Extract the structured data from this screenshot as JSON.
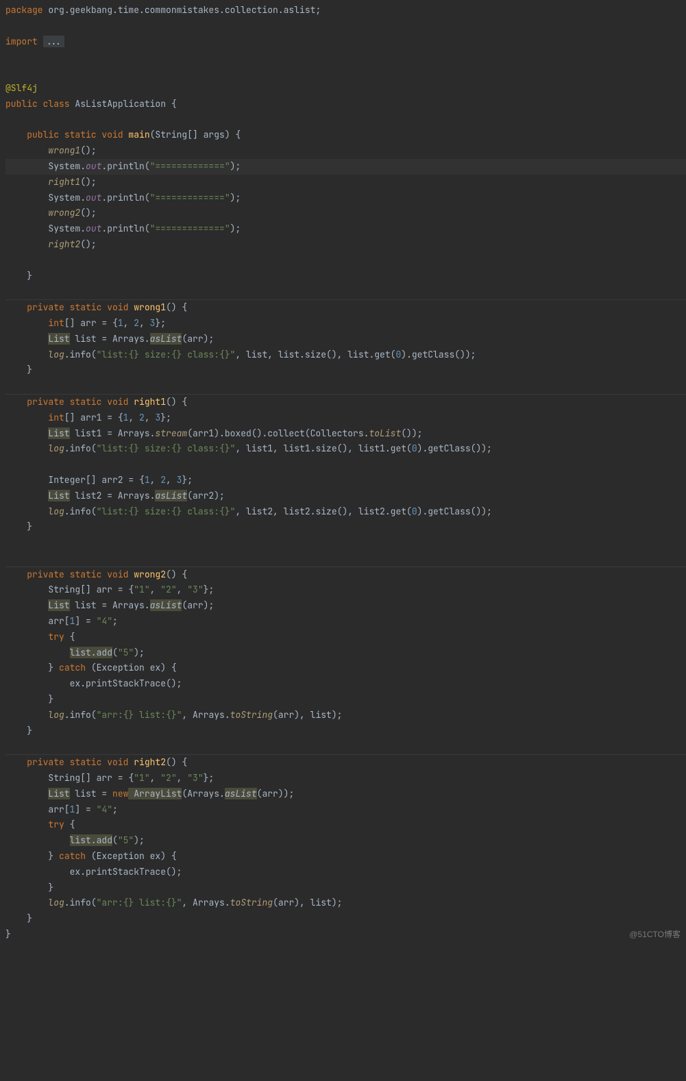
{
  "package_kw": "package",
  "package_name": "org.geekbang.time.commonmistakes.collection.aslist",
  "import_kw": "import",
  "import_dots": "...",
  "annotation": "@Slf4j",
  "class_decl": {
    "mods": "public class",
    "name": "AsListApplication",
    "open": " {"
  },
  "main": {
    "sig_mods": "public static void",
    "name": "main",
    "params": "(String[] args) {",
    "body": [
      {
        "call": "wrong1",
        "after": "();"
      },
      {
        "sysout_pre": "System.",
        "out": "out",
        "println": ".println(",
        "str": "\"=============\"",
        "end": ");"
      },
      {
        "call": "right1",
        "after": "();"
      },
      {
        "sysout_pre": "System.",
        "out": "out",
        "println": ".println(",
        "str": "\"=============\"",
        "end": ");"
      },
      {
        "call": "wrong2",
        "after": "();"
      },
      {
        "sysout_pre": "System.",
        "out": "out",
        "println": ".println(",
        "str": "\"=============\"",
        "end": ");"
      },
      {
        "call": "right2",
        "after": "();"
      }
    ]
  },
  "wrong1": {
    "sig_mods": "private static void",
    "name": "wrong1",
    "params": "() {",
    "l1_kw": "int",
    "l1_rest": "[] arr = {",
    "l1_n1": "1",
    "l1_n2": "2",
    "l1_n3": "3",
    "l1_end": "};",
    "l2_list": "List",
    "l2_mid": " list = Arrays.",
    "l2_aslist": "asList",
    "l2_end": "(arr);",
    "l3_log": "log",
    "l3_mid": ".info(",
    "l3_str": "\"list:{} size:{} class:{}\"",
    "l3_args": ", list, list.size(), list.get(",
    "l3_zero": "0",
    "l3_end": ").getClass());"
  },
  "right1": {
    "sig_mods": "private static void",
    "name": "right1",
    "params": "() {",
    "l1_kw": "int",
    "l1_rest": "[] arr1 = {",
    "l1_n1": "1",
    "l1_n2": "2",
    "l1_n3": "3",
    "l1_end": "};",
    "l2_list": "List",
    "l2_mid": " list1 = Arrays.",
    "l2_stream": "stream",
    "l2_after_stream": "(arr1).boxed().collect(Collectors.",
    "l2_tolist": "toList",
    "l2_end": "());",
    "l3_log": "log",
    "l3_mid": ".info(",
    "l3_str": "\"list:{} size:{} class:{}\"",
    "l3_args": ", list1, list1.size(), list1.get(",
    "l3_zero": "0",
    "l3_end": ").getClass());",
    "l5_pre": "Integer[] arr2 = {",
    "l5_n1": "1",
    "l5_n2": "2",
    "l5_n3": "3",
    "l5_end": "};",
    "l6_list": "List",
    "l6_mid": " list2 = Arrays.",
    "l6_aslist": "asList",
    "l6_end": "(arr2);",
    "l7_log": "log",
    "l7_mid": ".info(",
    "l7_str": "\"list:{} size:{} class:{}\"",
    "l7_args": ", list2, list2.size(), list2.get(",
    "l7_zero": "0",
    "l7_end": ").getClass());"
  },
  "wrong2": {
    "sig_mods": "private static void",
    "name": "wrong2",
    "params": "() {",
    "l1": "String[] arr = {",
    "l1_s1": "\"1\"",
    "l1_s2": "\"2\"",
    "l1_s3": "\"3\"",
    "l1_end": "};",
    "l2_list": "List",
    "l2_mid": " list = Arrays.",
    "l2_aslist": "asList",
    "l2_end": "(arr);",
    "l3_pre": "arr[",
    "l3_idx": "1",
    "l3_mid": "] = ",
    "l3_val": "\"4\"",
    "l3_end": ";",
    "l4_try": "try",
    "l4_after": " {",
    "l5_hi": "list.add",
    "l5_open": "(",
    "l5_str": "\"5\"",
    "l5_end": ");",
    "l6_close": "} ",
    "l6_catch": "catch",
    "l6_after": " (Exception ex) {",
    "l7": "ex.printStackTrace();",
    "l8": "}",
    "l9_log": "log",
    "l9_mid": ".info(",
    "l9_str": "\"arr:{} list:{}\"",
    "l9_args": ", Arrays.",
    "l9_tostr": "toString",
    "l9_end": "(arr), list);"
  },
  "right2": {
    "sig_mods": "private static void",
    "name": "right2",
    "params": "() {",
    "l1": "String[] arr = {",
    "l1_s1": "\"1\"",
    "l1_s2": "\"2\"",
    "l1_s3": "\"3\"",
    "l1_end": "};",
    "l2_list": "List",
    "l2_mid": " list = ",
    "l2_new": "new",
    "l2_al": " ArrayList",
    "l2_after": "(Arrays.",
    "l2_aslist": "asList",
    "l2_end": "(arr));",
    "l3_pre": "arr[",
    "l3_idx": "1",
    "l3_mid": "] = ",
    "l3_val": "\"4\"",
    "l3_end": ";",
    "l4_try": "try",
    "l4_after": " {",
    "l5_hi": "list.add",
    "l5_open": "(",
    "l5_str": "\"5\"",
    "l5_end": ");",
    "l6_close": "} ",
    "l6_catch": "catch",
    "l6_after": " (Exception ex) {",
    "l7": "ex.printStackTrace();",
    "l8": "}",
    "l9_log": "log",
    "l9_mid": ".info(",
    "l9_str": "\"arr:{} list:{}\"",
    "l9_args": ", Arrays.",
    "l9_tostr": "toString",
    "l9_end": "(arr), list);"
  },
  "watermark": "@51CTO博客"
}
